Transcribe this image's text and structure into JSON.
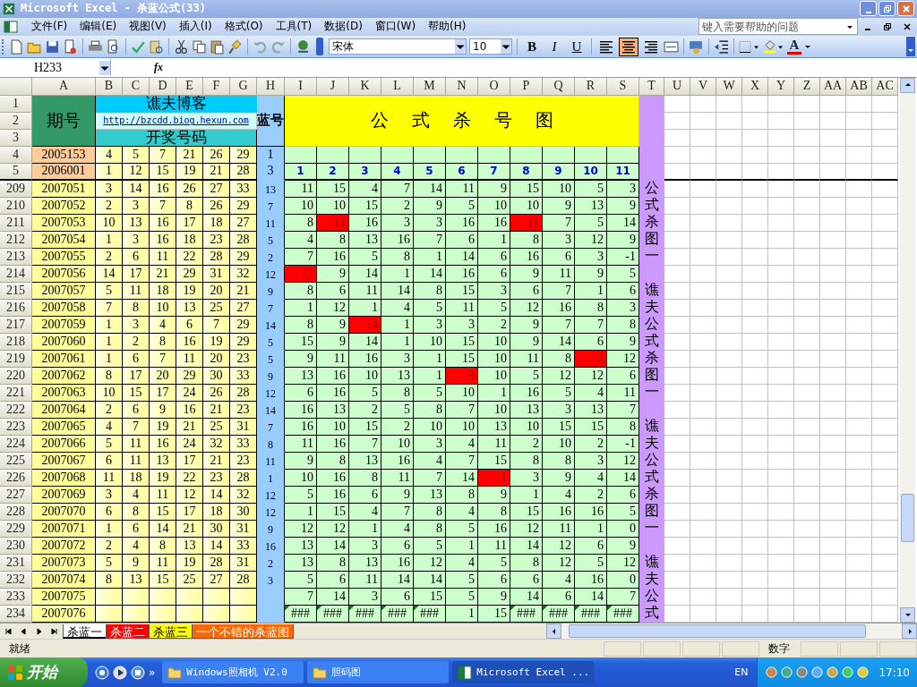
{
  "window": {
    "title": "Microsoft Excel - 杀蓝公式(33)"
  },
  "menu": [
    "文件(F)",
    "编辑(E)",
    "视图(V)",
    "插入(I)",
    "格式(O)",
    "工具(T)",
    "数据(D)",
    "窗口(W)",
    "帮助(H)"
  ],
  "help_box": {
    "placeholder": "键入需要帮助的问题"
  },
  "font_box": {
    "value": "宋体"
  },
  "size_box": {
    "value": "10"
  },
  "format_buttons": [
    {
      "label": "B",
      "selected": false
    },
    {
      "label": "I",
      "selected": false
    },
    {
      "label": "U",
      "selected": false
    }
  ],
  "align_buttons": [
    {
      "selected": false
    },
    {
      "selected": true
    },
    {
      "selected": false
    }
  ],
  "font_color_label": "A",
  "name_box": "H233",
  "fx_label": "fx",
  "columns": [
    "A",
    "B",
    "C",
    "D",
    "E",
    "F",
    "G",
    "H",
    "I",
    "J",
    "K",
    "L",
    "M",
    "N",
    "O",
    "P",
    "Q",
    "R",
    "S",
    "T",
    "U",
    "V",
    "W",
    "X",
    "Y",
    "Z",
    "AA",
    "AB",
    "AC"
  ],
  "header": {
    "row_numbers": [
      "1",
      "2",
      "3"
    ],
    "period_label": "期号",
    "blog_title": "谯夫博客",
    "blog_link": "http://bzcdd.biog.hexun.com",
    "draw_label": "开奖号码",
    "blue_label": "蓝号",
    "chart_title": "公式杀号图"
  },
  "top_rows": [
    {
      "n": "4",
      "period": "2005153",
      "balls": [
        "4",
        "5",
        "7",
        "21",
        "26",
        "29"
      ],
      "blue": "1"
    },
    {
      "n": "5",
      "period": "2006001",
      "balls": [
        "1",
        "12",
        "15",
        "19",
        "21",
        "28"
      ],
      "blue": "3",
      "formulas": [
        "1",
        "2",
        "3",
        "4",
        "5",
        "6",
        "7",
        "8",
        "9",
        "10",
        "11"
      ]
    }
  ],
  "rows": [
    {
      "n": "209",
      "period": "2007051",
      "balls": [
        "3",
        "14",
        "16",
        "26",
        "27",
        "33"
      ],
      "blue": "13",
      "t": "公",
      "kills": [
        {
          "v": "11",
          "hit": false
        },
        {
          "v": "15",
          "hit": false
        },
        {
          "v": "4",
          "hit": false
        },
        {
          "v": "7",
          "hit": false
        },
        {
          "v": "14",
          "hit": false
        },
        {
          "v": "11",
          "hit": false
        },
        {
          "v": "9",
          "hit": false
        },
        {
          "v": "15",
          "hit": false
        },
        {
          "v": "10",
          "hit": false
        },
        {
          "v": "5",
          "hit": false
        },
        {
          "v": "3",
          "hit": false
        }
      ]
    },
    {
      "n": "210",
      "period": "2007052",
      "balls": [
        "2",
        "3",
        "7",
        "8",
        "26",
        "29"
      ],
      "blue": "7",
      "t": "式",
      "kills": [
        {
          "v": "10",
          "hit": false
        },
        {
          "v": "10",
          "hit": false
        },
        {
          "v": "15",
          "hit": false
        },
        {
          "v": "2",
          "hit": false
        },
        {
          "v": "9",
          "hit": false
        },
        {
          "v": "5",
          "hit": false
        },
        {
          "v": "10",
          "hit": false
        },
        {
          "v": "10",
          "hit": false
        },
        {
          "v": "9",
          "hit": false
        },
        {
          "v": "13",
          "hit": false
        },
        {
          "v": "9",
          "hit": false
        }
      ]
    },
    {
      "n": "211",
      "period": "2007053",
      "balls": [
        "10",
        "13",
        "16",
        "17",
        "18",
        "27"
      ],
      "blue": "11",
      "t": "杀",
      "kills": [
        {
          "v": "8",
          "hit": false
        },
        {
          "v": "11",
          "hit": true
        },
        {
          "v": "16",
          "hit": false
        },
        {
          "v": "3",
          "hit": false
        },
        {
          "v": "3",
          "hit": false
        },
        {
          "v": "16",
          "hit": false
        },
        {
          "v": "16",
          "hit": false
        },
        {
          "v": "11",
          "hit": true
        },
        {
          "v": "7",
          "hit": false
        },
        {
          "v": "5",
          "hit": false
        },
        {
          "v": "14",
          "hit": false
        }
      ]
    },
    {
      "n": "212",
      "period": "2007054",
      "balls": [
        "1",
        "3",
        "16",
        "18",
        "23",
        "28"
      ],
      "blue": "5",
      "t": "图",
      "kills": [
        {
          "v": "4",
          "hit": false
        },
        {
          "v": "8",
          "hit": false
        },
        {
          "v": "13",
          "hit": false
        },
        {
          "v": "16",
          "hit": false
        },
        {
          "v": "7",
          "hit": false
        },
        {
          "v": "6",
          "hit": false
        },
        {
          "v": "1",
          "hit": false
        },
        {
          "v": "8",
          "hit": false
        },
        {
          "v": "3",
          "hit": false
        },
        {
          "v": "12",
          "hit": false
        },
        {
          "v": "9",
          "hit": false
        }
      ]
    },
    {
      "n": "213",
      "period": "2007055",
      "balls": [
        "2",
        "6",
        "11",
        "22",
        "28",
        "29"
      ],
      "blue": "2",
      "t": "一",
      "kills": [
        {
          "v": "7",
          "hit": false
        },
        {
          "v": "16",
          "hit": false
        },
        {
          "v": "5",
          "hit": false
        },
        {
          "v": "8",
          "hit": false
        },
        {
          "v": "1",
          "hit": false
        },
        {
          "v": "14",
          "hit": false
        },
        {
          "v": "6",
          "hit": false
        },
        {
          "v": "16",
          "hit": false
        },
        {
          "v": "6",
          "hit": false
        },
        {
          "v": "3",
          "hit": false
        },
        {
          "v": "-1",
          "hit": false
        }
      ]
    },
    {
      "n": "214",
      "period": "2007056",
      "balls": [
        "14",
        "17",
        "21",
        "29",
        "31",
        "32"
      ],
      "blue": "12",
      "kills": [
        {
          "v": "12",
          "hit": true
        },
        {
          "v": "9",
          "hit": false
        },
        {
          "v": "14",
          "hit": false
        },
        {
          "v": "1",
          "hit": false
        },
        {
          "v": "14",
          "hit": false
        },
        {
          "v": "16",
          "hit": false
        },
        {
          "v": "6",
          "hit": false
        },
        {
          "v": "9",
          "hit": false
        },
        {
          "v": "11",
          "hit": false
        },
        {
          "v": "9",
          "hit": false
        },
        {
          "v": "5",
          "hit": false
        }
      ]
    },
    {
      "n": "215",
      "period": "2007057",
      "balls": [
        "5",
        "11",
        "18",
        "19",
        "20",
        "21"
      ],
      "blue": "9",
      "t": "谯",
      "kills": [
        {
          "v": "8",
          "hit": false
        },
        {
          "v": "6",
          "hit": false
        },
        {
          "v": "11",
          "hit": false
        },
        {
          "v": "14",
          "hit": false
        },
        {
          "v": "8",
          "hit": false
        },
        {
          "v": "15",
          "hit": false
        },
        {
          "v": "3",
          "hit": false
        },
        {
          "v": "6",
          "hit": false
        },
        {
          "v": "7",
          "hit": false
        },
        {
          "v": "1",
          "hit": false
        },
        {
          "v": "6",
          "hit": false
        }
      ]
    },
    {
      "n": "216",
      "period": "2007058",
      "balls": [
        "7",
        "8",
        "10",
        "13",
        "25",
        "27"
      ],
      "blue": "7",
      "t": "夫",
      "kills": [
        {
          "v": "1",
          "hit": false
        },
        {
          "v": "12",
          "hit": false
        },
        {
          "v": "1",
          "hit": false
        },
        {
          "v": "4",
          "hit": false
        },
        {
          "v": "5",
          "hit": false
        },
        {
          "v": "11",
          "hit": false
        },
        {
          "v": "5",
          "hit": false
        },
        {
          "v": "12",
          "hit": false
        },
        {
          "v": "16",
          "hit": false
        },
        {
          "v": "8",
          "hit": false
        },
        {
          "v": "3",
          "hit": false
        }
      ]
    },
    {
      "n": "217",
      "period": "2007059",
      "balls": [
        "1",
        "3",
        "4",
        "6",
        "7",
        "29"
      ],
      "blue": "14",
      "t": "公",
      "kills": [
        {
          "v": "8",
          "hit": false
        },
        {
          "v": "9",
          "hit": false
        },
        {
          "v": "14",
          "hit": true
        },
        {
          "v": "1",
          "hit": false
        },
        {
          "v": "3",
          "hit": false
        },
        {
          "v": "3",
          "hit": false
        },
        {
          "v": "2",
          "hit": false
        },
        {
          "v": "9",
          "hit": false
        },
        {
          "v": "7",
          "hit": false
        },
        {
          "v": "7",
          "hit": false
        },
        {
          "v": "8",
          "hit": false
        }
      ]
    },
    {
      "n": "218",
      "period": "2007060",
      "balls": [
        "1",
        "2",
        "8",
        "16",
        "19",
        "29"
      ],
      "blue": "5",
      "t": "式",
      "kills": [
        {
          "v": "15",
          "hit": false
        },
        {
          "v": "9",
          "hit": false
        },
        {
          "v": "14",
          "hit": false
        },
        {
          "v": "1",
          "hit": false
        },
        {
          "v": "10",
          "hit": false
        },
        {
          "v": "15",
          "hit": false
        },
        {
          "v": "10",
          "hit": false
        },
        {
          "v": "9",
          "hit": false
        },
        {
          "v": "14",
          "hit": false
        },
        {
          "v": "6",
          "hit": false
        },
        {
          "v": "9",
          "hit": false
        }
      ]
    },
    {
      "n": "219",
      "period": "2007061",
      "balls": [
        "1",
        "6",
        "7",
        "11",
        "20",
        "23"
      ],
      "blue": "5",
      "t": "杀",
      "kills": [
        {
          "v": "9",
          "hit": false
        },
        {
          "v": "11",
          "hit": false
        },
        {
          "v": "16",
          "hit": false
        },
        {
          "v": "3",
          "hit": false
        },
        {
          "v": "1",
          "hit": false
        },
        {
          "v": "15",
          "hit": false
        },
        {
          "v": "10",
          "hit": false
        },
        {
          "v": "11",
          "hit": false
        },
        {
          "v": "8",
          "hit": false
        },
        {
          "v": "5",
          "hit": true
        },
        {
          "v": "12",
          "hit": false
        }
      ]
    },
    {
      "n": "220",
      "period": "2007062",
      "balls": [
        "8",
        "17",
        "20",
        "29",
        "30",
        "33"
      ],
      "blue": "9",
      "t": "图",
      "kills": [
        {
          "v": "13",
          "hit": false
        },
        {
          "v": "16",
          "hit": false
        },
        {
          "v": "10",
          "hit": false
        },
        {
          "v": "13",
          "hit": false
        },
        {
          "v": "1",
          "hit": false
        },
        {
          "v": "9",
          "hit": true
        },
        {
          "v": "10",
          "hit": false
        },
        {
          "v": "5",
          "hit": false
        },
        {
          "v": "12",
          "hit": false
        },
        {
          "v": "12",
          "hit": false
        },
        {
          "v": "6",
          "hit": false
        }
      ]
    },
    {
      "n": "221",
      "period": "2007063",
      "balls": [
        "10",
        "15",
        "17",
        "24",
        "26",
        "28"
      ],
      "blue": "12",
      "t": "一",
      "kills": [
        {
          "v": "6",
          "hit": false
        },
        {
          "v": "16",
          "hit": false
        },
        {
          "v": "5",
          "hit": false
        },
        {
          "v": "8",
          "hit": false
        },
        {
          "v": "5",
          "hit": false
        },
        {
          "v": "10",
          "hit": false
        },
        {
          "v": "1",
          "hit": false
        },
        {
          "v": "16",
          "hit": false
        },
        {
          "v": "5",
          "hit": false
        },
        {
          "v": "4",
          "hit": false
        },
        {
          "v": "11",
          "hit": false
        }
      ]
    },
    {
      "n": "222",
      "period": "2007064",
      "balls": [
        "2",
        "6",
        "9",
        "16",
        "21",
        "23"
      ],
      "blue": "14",
      "kills": [
        {
          "v": "16",
          "hit": false
        },
        {
          "v": "13",
          "hit": false
        },
        {
          "v": "2",
          "hit": false
        },
        {
          "v": "5",
          "hit": false
        },
        {
          "v": "8",
          "hit": false
        },
        {
          "v": "7",
          "hit": false
        },
        {
          "v": "10",
          "hit": false
        },
        {
          "v": "13",
          "hit": false
        },
        {
          "v": "3",
          "hit": false
        },
        {
          "v": "13",
          "hit": false
        },
        {
          "v": "7",
          "hit": false
        }
      ]
    },
    {
      "n": "223",
      "period": "2007065",
      "balls": [
        "4",
        "7",
        "19",
        "21",
        "25",
        "31"
      ],
      "blue": "7",
      "t": "谯",
      "kills": [
        {
          "v": "16",
          "hit": false
        },
        {
          "v": "10",
          "hit": false
        },
        {
          "v": "15",
          "hit": false
        },
        {
          "v": "2",
          "hit": false
        },
        {
          "v": "10",
          "hit": false
        },
        {
          "v": "10",
          "hit": false
        },
        {
          "v": "13",
          "hit": false
        },
        {
          "v": "10",
          "hit": false
        },
        {
          "v": "15",
          "hit": false
        },
        {
          "v": "15",
          "hit": false
        },
        {
          "v": "8",
          "hit": false
        }
      ]
    },
    {
      "n": "224",
      "period": "2007066",
      "balls": [
        "5",
        "11",
        "16",
        "24",
        "32",
        "33"
      ],
      "blue": "8",
      "t": "夫",
      "kills": [
        {
          "v": "11",
          "hit": false
        },
        {
          "v": "16",
          "hit": false
        },
        {
          "v": "7",
          "hit": false
        },
        {
          "v": "10",
          "hit": false
        },
        {
          "v": "3",
          "hit": false
        },
        {
          "v": "4",
          "hit": false
        },
        {
          "v": "11",
          "hit": false
        },
        {
          "v": "2",
          "hit": false
        },
        {
          "v": "10",
          "hit": false
        },
        {
          "v": "2",
          "hit": false
        },
        {
          "v": "-1",
          "hit": false
        }
      ]
    },
    {
      "n": "225",
      "period": "2007067",
      "balls": [
        "6",
        "11",
        "13",
        "17",
        "21",
        "23"
      ],
      "blue": "11",
      "t": "公",
      "kills": [
        {
          "v": "9",
          "hit": false
        },
        {
          "v": "8",
          "hit": false
        },
        {
          "v": "13",
          "hit": false
        },
        {
          "v": "16",
          "hit": false
        },
        {
          "v": "4",
          "hit": false
        },
        {
          "v": "7",
          "hit": false
        },
        {
          "v": "15",
          "hit": false
        },
        {
          "v": "8",
          "hit": false
        },
        {
          "v": "8",
          "hit": false
        },
        {
          "v": "3",
          "hit": false
        },
        {
          "v": "12",
          "hit": false
        }
      ]
    },
    {
      "n": "226",
      "period": "2007068",
      "balls": [
        "11",
        "18",
        "19",
        "22",
        "23",
        "28"
      ],
      "blue": "1",
      "t": "式",
      "kills": [
        {
          "v": "10",
          "hit": false
        },
        {
          "v": "16",
          "hit": false
        },
        {
          "v": "8",
          "hit": false
        },
        {
          "v": "11",
          "hit": false
        },
        {
          "v": "7",
          "hit": false
        },
        {
          "v": "14",
          "hit": false
        },
        {
          "v": "1",
          "hit": true
        },
        {
          "v": "3",
          "hit": false
        },
        {
          "v": "9",
          "hit": false
        },
        {
          "v": "4",
          "hit": false
        },
        {
          "v": "14",
          "hit": false
        }
      ]
    },
    {
      "n": "227",
      "period": "2007069",
      "balls": [
        "3",
        "4",
        "11",
        "12",
        "14",
        "32"
      ],
      "blue": "12",
      "t": "杀",
      "kills": [
        {
          "v": "5",
          "hit": false
        },
        {
          "v": "16",
          "hit": false
        },
        {
          "v": "6",
          "hit": false
        },
        {
          "v": "9",
          "hit": false
        },
        {
          "v": "13",
          "hit": false
        },
        {
          "v": "8",
          "hit": false
        },
        {
          "v": "9",
          "hit": false
        },
        {
          "v": "1",
          "hit": false
        },
        {
          "v": "4",
          "hit": false
        },
        {
          "v": "2",
          "hit": false
        },
        {
          "v": "6",
          "hit": false
        }
      ]
    },
    {
      "n": "228",
      "period": "2007070",
      "balls": [
        "6",
        "8",
        "15",
        "17",
        "18",
        "30"
      ],
      "blue": "12",
      "t": "图",
      "kills": [
        {
          "v": "1",
          "hit": false
        },
        {
          "v": "15",
          "hit": false
        },
        {
          "v": "4",
          "hit": false
        },
        {
          "v": "7",
          "hit": false
        },
        {
          "v": "8",
          "hit": false
        },
        {
          "v": "4",
          "hit": false
        },
        {
          "v": "8",
          "hit": false
        },
        {
          "v": "15",
          "hit": false
        },
        {
          "v": "16",
          "hit": false
        },
        {
          "v": "16",
          "hit": false
        },
        {
          "v": "5",
          "hit": false
        }
      ]
    },
    {
      "n": "229",
      "period": "2007071",
      "balls": [
        "1",
        "6",
        "14",
        "21",
        "30",
        "31"
      ],
      "blue": "9",
      "t": "一",
      "kills": [
        {
          "v": "12",
          "hit": false
        },
        {
          "v": "12",
          "hit": false
        },
        {
          "v": "1",
          "hit": false
        },
        {
          "v": "4",
          "hit": false
        },
        {
          "v": "8",
          "hit": false
        },
        {
          "v": "5",
          "hit": false
        },
        {
          "v": "16",
          "hit": false
        },
        {
          "v": "12",
          "hit": false
        },
        {
          "v": "11",
          "hit": false
        },
        {
          "v": "1",
          "hit": false
        },
        {
          "v": "0",
          "hit": false
        }
      ]
    },
    {
      "n": "230",
      "period": "2007072",
      "balls": [
        "2",
        "4",
        "8",
        "13",
        "14",
        "33"
      ],
      "blue": "16",
      "kills": [
        {
          "v": "13",
          "hit": false
        },
        {
          "v": "14",
          "hit": false
        },
        {
          "v": "3",
          "hit": false
        },
        {
          "v": "6",
          "hit": false
        },
        {
          "v": "5",
          "hit": false
        },
        {
          "v": "1",
          "hit": false
        },
        {
          "v": "11",
          "hit": false
        },
        {
          "v": "14",
          "hit": false
        },
        {
          "v": "12",
          "hit": false
        },
        {
          "v": "6",
          "hit": false
        },
        {
          "v": "9",
          "hit": false
        }
      ]
    },
    {
      "n": "231",
      "period": "2007073",
      "balls": [
        "5",
        "9",
        "11",
        "19",
        "28",
        "31"
      ],
      "blue": "2",
      "t": "谯",
      "kills": [
        {
          "v": "13",
          "hit": false
        },
        {
          "v": "8",
          "hit": false
        },
        {
          "v": "13",
          "hit": false
        },
        {
          "v": "16",
          "hit": false
        },
        {
          "v": "12",
          "hit": false
        },
        {
          "v": "4",
          "hit": false
        },
        {
          "v": "5",
          "hit": false
        },
        {
          "v": "8",
          "hit": false
        },
        {
          "v": "12",
          "hit": false
        },
        {
          "v": "5",
          "hit": false
        },
        {
          "v": "12",
          "hit": false
        }
      ]
    },
    {
      "n": "232",
      "period": "2007074",
      "balls": [
        "8",
        "13",
        "15",
        "25",
        "27",
        "28"
      ],
      "blue": "3",
      "t": "夫",
      "kills": [
        {
          "v": "5",
          "hit": false
        },
        {
          "v": "6",
          "hit": false
        },
        {
          "v": "11",
          "hit": false
        },
        {
          "v": "14",
          "hit": false
        },
        {
          "v": "14",
          "hit": false
        },
        {
          "v": "5",
          "hit": false
        },
        {
          "v": "6",
          "hit": false
        },
        {
          "v": "6",
          "hit": false
        },
        {
          "v": "4",
          "hit": false
        },
        {
          "v": "16",
          "hit": false
        },
        {
          "v": "0",
          "hit": false
        }
      ]
    },
    {
      "n": "233",
      "period": "2007075",
      "t": "公",
      "kills": [
        {
          "v": "7",
          "hit": false
        },
        {
          "v": "14",
          "hit": false
        },
        {
          "v": "3",
          "hit": false
        },
        {
          "v": "6",
          "hit": false
        },
        {
          "v": "15",
          "hit": false
        },
        {
          "v": "5",
          "hit": false
        },
        {
          "v": "9",
          "hit": false
        },
        {
          "v": "14",
          "hit": false
        },
        {
          "v": "6",
          "hit": false
        },
        {
          "v": "14",
          "hit": false
        },
        {
          "v": "7",
          "hit": false
        }
      ]
    },
    {
      "n": "234",
      "period": "2007076",
      "t": "式",
      "kills": [
        {
          "v": "###",
          "hit": false,
          "flag": true
        },
        {
          "v": "###",
          "hit": false,
          "flag": true
        },
        {
          "v": "###",
          "hit": false,
          "flag": true
        },
        {
          "v": "###",
          "hit": false,
          "flag": true
        },
        {
          "v": "###",
          "hit": false,
          "flag": true
        },
        {
          "v": "1",
          "hit": false,
          "flag": false
        },
        {
          "v": "15",
          "hit": false,
          "flag": false
        },
        {
          "v": "###",
          "hit": false,
          "flag": true
        },
        {
          "v": "###",
          "hit": false,
          "flag": true
        },
        {
          "v": "###",
          "hit": false,
          "flag": true
        },
        {
          "v": "###",
          "hit": false,
          "flag": true
        }
      ]
    }
  ],
  "sheet_tabs": [
    {
      "label": "杀蓝一",
      "selected": true,
      "color": "#ffffff"
    },
    {
      "label": "杀蓝二",
      "selected": false,
      "color": "#ff0000"
    },
    {
      "label": "杀蓝三",
      "selected": false,
      "color": "#ffff00"
    },
    {
      "label": "一个不错的杀蓝图",
      "selected": false,
      "color": "#ff6600"
    }
  ],
  "status_bar": {
    "left": "就绪",
    "mode": "数字"
  },
  "taskbar": {
    "start": "开始",
    "more": "»",
    "tasks": [
      {
        "label": "Windows照相机 V2.0",
        "selected": false,
        "kind": "folder"
      },
      {
        "label": "胆码图",
        "selected": false,
        "kind": "folder"
      },
      {
        "label": "Microsoft Excel ...",
        "selected": true,
        "kind": "excel"
      }
    ],
    "lang": "EN",
    "clock": "17:10"
  }
}
